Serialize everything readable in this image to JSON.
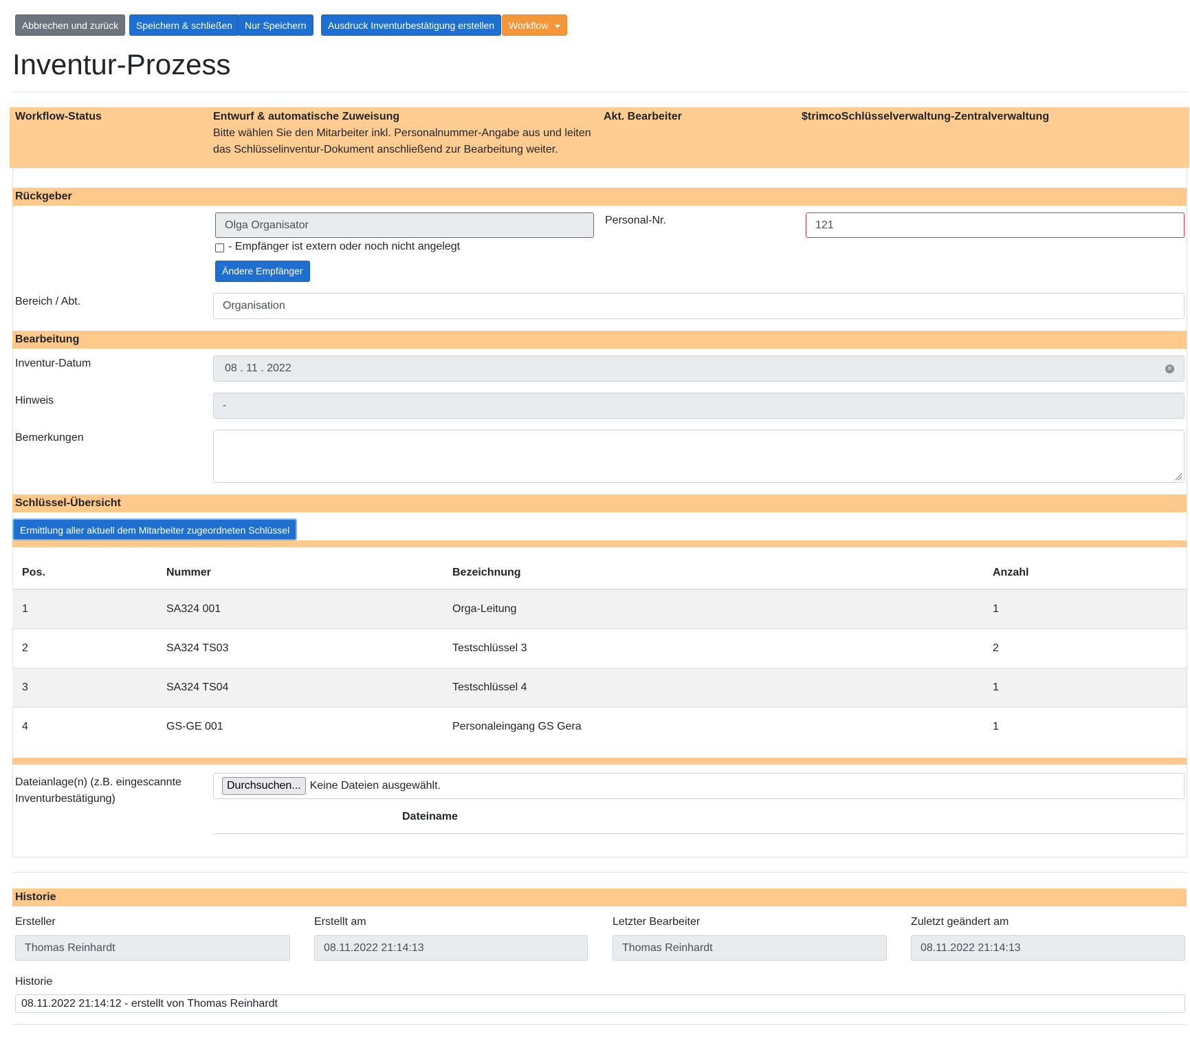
{
  "toolbar": {
    "cancel_label": "Abbrechen und zurück",
    "save_close_label": "Speichern & schließen",
    "save_only_label": "Nur Speichern",
    "print_label": "Ausdruck Inventurbestätigung erstellen",
    "workflow_label": "Workflow"
  },
  "page": {
    "title": "Inventur-Prozess"
  },
  "status": {
    "label": "Workflow-Status",
    "state_title": "Entwurf & automatische Zuweisung",
    "state_line1": "Bitte wählen Sie den Mitarbeiter inkl. Personalnummer-Angabe aus und leiten",
    "state_line2": "das Schlüsselinventur-Dokument anschließend zur Bearbeitung weiter.",
    "editor_label": "Akt. Bearbeiter",
    "editor_value": "$trimcoSchlüsselverwaltung-Zentralverwaltung"
  },
  "rueckgeber": {
    "section": "Rückgeber",
    "name_value": "Olga Organisator",
    "personal_label": "Personal-Nr.",
    "personal_value": "121",
    "checkbox_label": "- Empfänger ist extern oder noch nicht angelegt",
    "change_button": "Ändere Empfänger",
    "bereich_label": "Bereich / Abt.",
    "bereich_value": "Organisation"
  },
  "bearbeitung": {
    "section": "Bearbeitung",
    "datum_label": "Inventur-Datum",
    "datum_value": "08 . 11 . 2022",
    "hinweis_label": "Hinweis",
    "hinweis_value": "-",
    "bemerkungen_label": "Bemerkungen",
    "bemerkungen_value": ""
  },
  "schluessel": {
    "section": "Schlüssel-Übersicht",
    "fetch_button": "Ermittlung aller aktuell dem Mitarbeiter zugeordneten Schlüssel",
    "columns": [
      "Pos.",
      "Nummer",
      "Bezeichnung",
      "Anzahl"
    ],
    "rows": [
      [
        "1",
        "SA324 001",
        "Orga-Leitung",
        "1"
      ],
      [
        "2",
        "SA324 TS03",
        "Testschlüssel 3",
        "2"
      ],
      [
        "3",
        "SA324 TS04",
        "Testschlüssel 4",
        "1"
      ],
      [
        "4",
        "GS-GE 001",
        "Personaleingang GS Gera",
        "1"
      ]
    ]
  },
  "dateianlage": {
    "label_line1": "Dateianlage(n) (z.B. eingescannte",
    "label_line2": "Inventurbestätigung)",
    "browse_button": "Durchsuchen...",
    "no_file_text": "Keine Dateien ausgewählt.",
    "column_header": "Dateiname"
  },
  "historie": {
    "section": "Historie",
    "ersteller_label": "Ersteller",
    "ersteller_value": "Thomas Reinhardt",
    "erstellt_label": "Erstellt am",
    "erstellt_value": "08.11.2022 21:14:13",
    "letzter_label": "Letzter Bearbeiter",
    "letzter_value": "Thomas Reinhardt",
    "geaendert_label": "Zuletzt geändert am",
    "geaendert_value": "08.11.2022 21:14:13",
    "historie_label": "Historie",
    "historie_value": "08.11.2022 21:14:12 - erstellt von Thomas Reinhardt"
  },
  "colors": {
    "accent_orange": "#ffc98c",
    "button_blue": "#1e6fd0",
    "button_gray": "#6c757d",
    "button_orange": "#f5963a",
    "error_red": "#dc3545"
  }
}
